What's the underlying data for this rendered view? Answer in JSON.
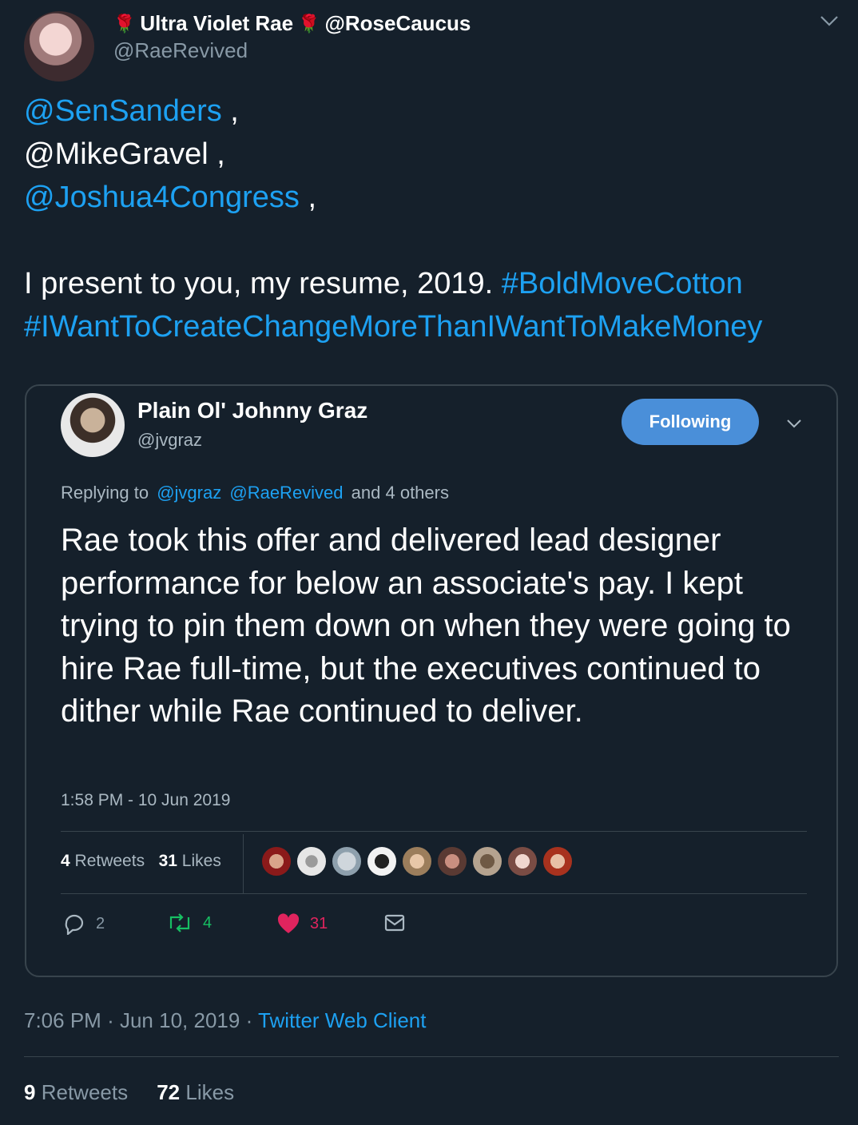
{
  "author": {
    "name": "Ultra Violet Rae",
    "name_handle": "@RoseCaucus",
    "screen_name": "@RaeRevived",
    "rose_glyph": "🌹"
  },
  "tweet": {
    "mention_1": "@SenSanders",
    "mention_2": "@MikeGravel",
    "mention_3": "@Joshua4Congress",
    "comma": ",",
    "body": "I present to you, my resume, 2019.",
    "hashtag_1": "#BoldMoveCotton",
    "hashtag_2": "#IWantToCreateChangeMoreThanIWantToMakeMoney"
  },
  "quoted": {
    "name": "Plain Ol' Johnny Graz",
    "handle": "@jvgraz",
    "follow_label": "Following",
    "replying_prefix": "Replying to",
    "replying_handle_1": "@jvgraz",
    "replying_handle_2": "@RaeRevived",
    "replying_suffix": "and 4 others",
    "text": "Rae took this offer and delivered lead designer performance for below an associate's pay. I kept trying to pin them down on when they were going to hire Rae full-time, but the executives continued to dither while Rae continued to deliver.",
    "timestamp": "1:58 PM - 10 Jun 2019",
    "retweets_count": "4",
    "retweets_label": "Retweets",
    "likes_count": "31",
    "likes_label": "Likes",
    "reply_count": "2",
    "retweet_action_count": "4",
    "like_action_count": "31"
  },
  "meta": {
    "time": "7:06 PM",
    "sep": "·",
    "date": "Jun 10, 2019",
    "client": "Twitter Web Client"
  },
  "totals": {
    "retweets_count": "9",
    "retweets_label": "Retweets",
    "likes_count": "72",
    "likes_label": "Likes"
  },
  "colors": {
    "background": "#15202b",
    "link": "#1da1f2",
    "muted": "#8899a6",
    "border": "#38444d",
    "follow_button": "#4a8fd9",
    "heart": "#e0245e",
    "retweet": "#17bf63"
  }
}
